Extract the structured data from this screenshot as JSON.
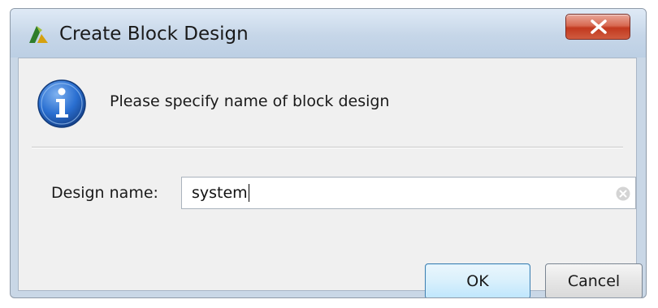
{
  "window": {
    "title": "Create Block Design",
    "app_icon": "vivado-logo-icon",
    "close_icon": "close-icon"
  },
  "message": {
    "icon": "info-icon",
    "text": "Please specify name of block design"
  },
  "form": {
    "design_name_label": "Design name:",
    "design_name_value": "system",
    "clear_icon": "clear-input-icon"
  },
  "buttons": {
    "ok_label": "OK",
    "cancel_label": "Cancel"
  },
  "colors": {
    "close_button": "#c2391f",
    "info_icon_blue": "#2a6fd1",
    "ok_border": "#3c7fb1"
  }
}
